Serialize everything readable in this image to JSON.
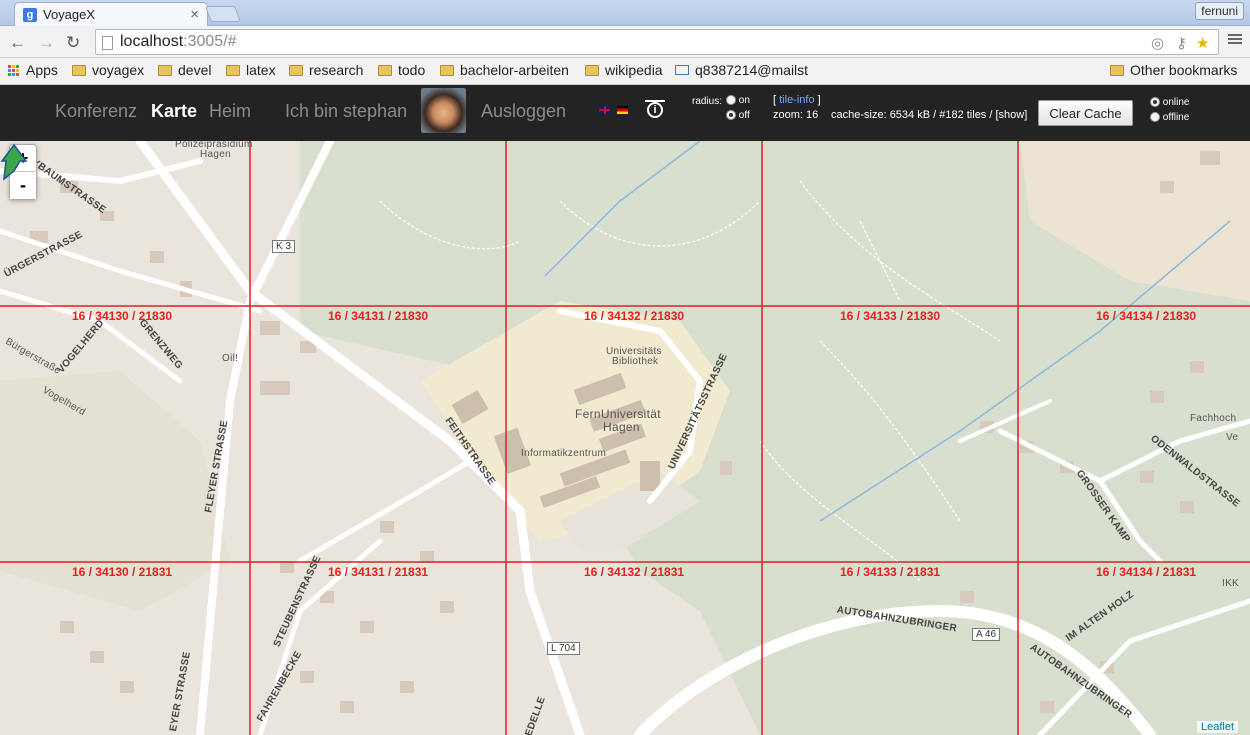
{
  "browser": {
    "tab_title": "VoyageX",
    "tab_favicon": "g",
    "user": "fernuni",
    "url_host": "localhost",
    "url_rest": ":3005/#"
  },
  "bookmarks": {
    "apps": "Apps",
    "items": [
      "voyagex",
      "devel",
      "latex",
      "research",
      "todo",
      "bachelor-arbeiten",
      "wikipedia"
    ],
    "mail": "q8387214@mailst",
    "other": "Other bookmarks"
  },
  "app": {
    "nav": {
      "konferenz": "Konferenz",
      "karte": "Karte",
      "heim": "Heim",
      "user": "Ich bin stephan",
      "logout": "Ausloggen"
    },
    "radius": {
      "label": "radius:",
      "on": "on",
      "off": "off",
      "selected": "off"
    },
    "tile_info": {
      "open": "[ ",
      "link": "tile-info",
      "close": " ]"
    },
    "zoom_text": "zoom: 16",
    "cache_text": "cache-size: 6534 kB / #182 tiles / [show]",
    "clear_cache": "Clear Cache",
    "mode": {
      "online": "online",
      "offline": "offline",
      "selected": "online"
    }
  },
  "map": {
    "zoom_in": "+",
    "zoom_out": "-",
    "attribution": "Leaflet",
    "tiles_row1": [
      "16 / 34130 / 21830",
      "16 / 34131 / 21830",
      "16 / 34132 / 21830",
      "16 / 34133 / 21830",
      "16 / 34134 / 21830"
    ],
    "tiles_row2": [
      "16 / 34130 / 21831",
      "16 / 34131 / 21831",
      "16 / 34132 / 21831",
      "16 / 34133 / 21831",
      "16 / 34134 / 21831"
    ],
    "labels": {
      "polizei": "Polizeipräsidium",
      "polizei2": "Hagen",
      "k3": "K 3",
      "baumstrasse": "YBAUMSTRASSE",
      "buergerstrasse": "ÜRGERSTRASSE",
      "vogelherd": "VOGELHERD",
      "grenzweg": "GRENZWEG",
      "buergerstrasse2": "Bürgerstraße",
      "vogelherd2": "Vogelherd",
      "oil": "Oil!",
      "fleyer": "FLEYER STRASSE",
      "feithstrasse": "FEITHSTRASSE",
      "bibliothek1": "Universitäts",
      "bibliothek2": "Bibliothek",
      "fernuni1": "FernUniversität",
      "fernuni2": "Hagen",
      "informatik": "Informatikzentrum",
      "universitaetsstrasse": "UNIVERSITÄTSSTRASSE",
      "grosser_kamp": "GROSSER KAMP",
      "odenwald": "ODENWALDSTRASSE",
      "fachhoch": "Fachhoch",
      "ve": "Ve",
      "steuben": "STEUBENSTRASSE",
      "fahrenbecke": "FAHRENBECKE",
      "l704": "L 704",
      "edelle": "EDELLE",
      "autobahn": "AUTOBAHNZUBRINGER",
      "a46": "A 46",
      "autobahn2": "AUTOBAHNZUBRINGER",
      "im_alten_holz": "IM ALTEN HOLZ",
      "ikk": "IKK",
      "fleyer2": "EYER STRASSE"
    }
  },
  "colors": {
    "tile_grid": "#e41f1f",
    "app_bar": "#232323",
    "map_bg": "#e9e4dc"
  }
}
